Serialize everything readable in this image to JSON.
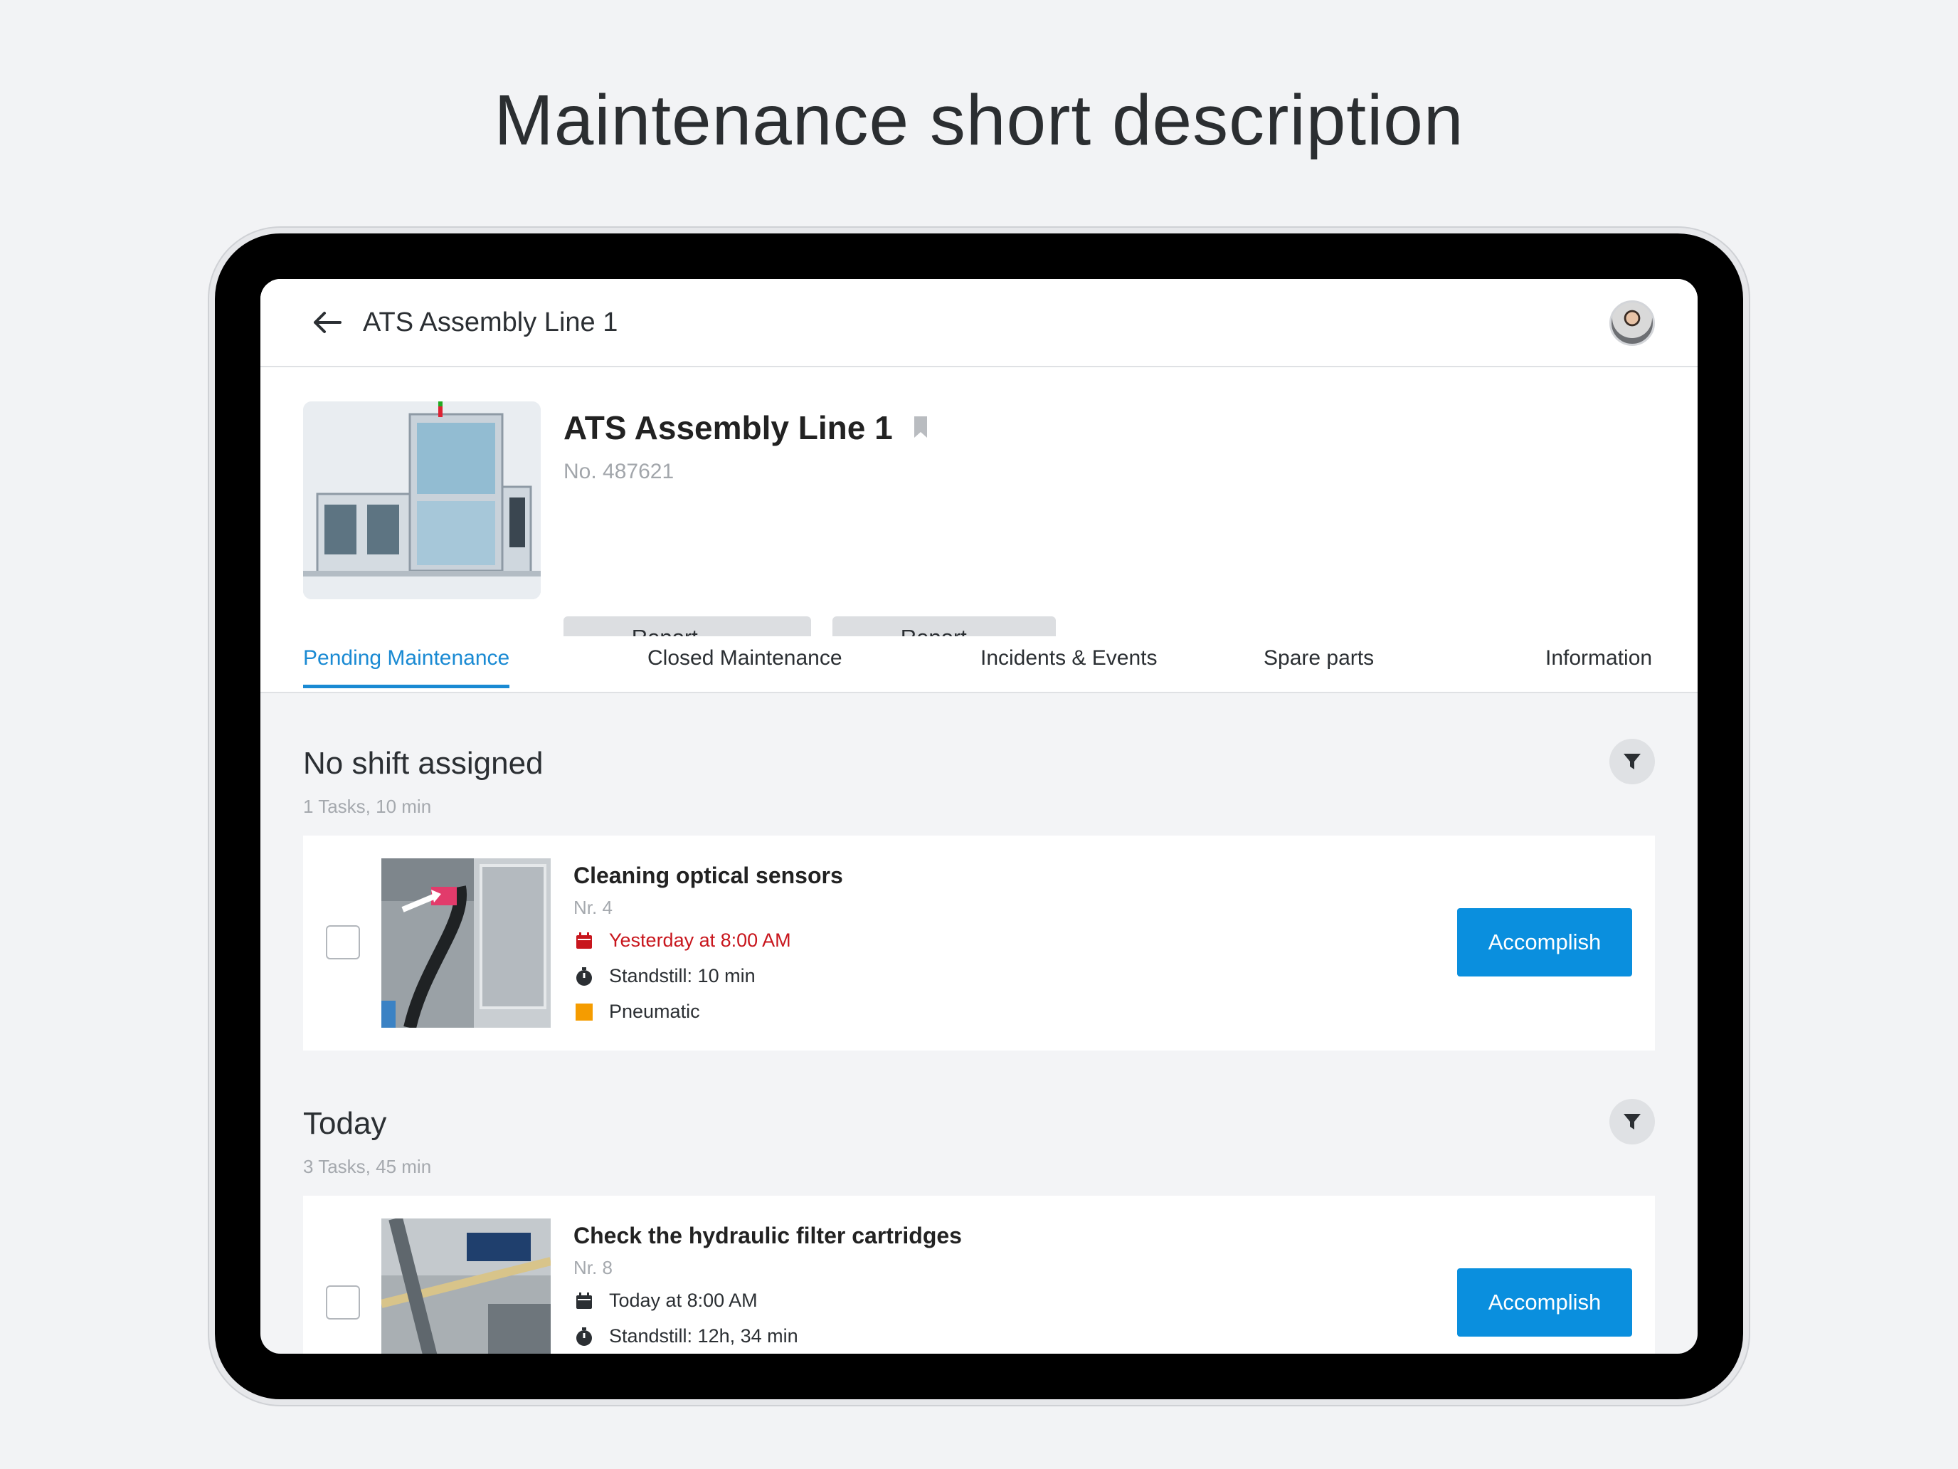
{
  "headline": "Maintenance short description",
  "topbar": {
    "title": "ATS Assembly Line 1"
  },
  "machine": {
    "title": "ATS Assembly Line 1",
    "number": "No. 487621"
  },
  "actions": {
    "report_incident": "Report Incident",
    "report_event": "Report Event"
  },
  "tabs": [
    {
      "label": "Pending Maintenance",
      "active": true
    },
    {
      "label": "Closed Maintenance"
    },
    {
      "label": "Incidents & Events"
    },
    {
      "label": "Spare parts"
    },
    {
      "label": "Information"
    }
  ],
  "sections": [
    {
      "title": "No shift assigned",
      "summary": "1 Tasks, 10 min",
      "tasks": [
        {
          "title": "Cleaning optical sensors",
          "nr": "Nr. 4",
          "due": "Yesterday at 8:00 AM",
          "standstill": "Standstill: 10 min",
          "category": "Pneumatic",
          "button": "Accomplish"
        }
      ]
    },
    {
      "title": "Today",
      "summary": "3 Tasks, 45 min",
      "tasks": [
        {
          "title": "Check the hydraulic filter cartridges",
          "nr": "Nr. 8",
          "due": "Today at 8:00 AM",
          "standstill": "Standstill: 12h, 34 min",
          "button": "Accomplish"
        }
      ]
    }
  ],
  "colors": {
    "accent": "#1a8ad3",
    "button_primary": "#0a8fde",
    "overdue": "#c8161d",
    "category_pneumatic": "#f59c00"
  }
}
